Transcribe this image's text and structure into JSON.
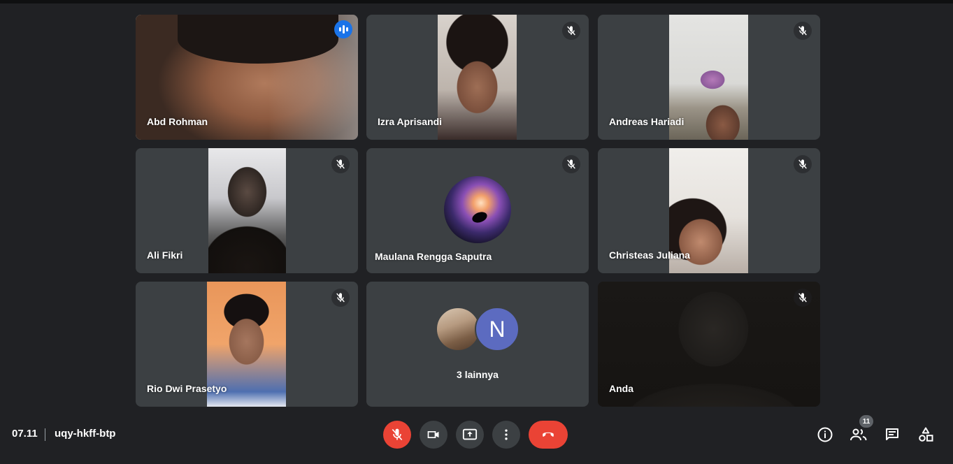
{
  "meeting": {
    "time": "07.11",
    "code": "uqy-hkff-btp",
    "participant_count": "11"
  },
  "tiles": [
    {
      "name": "Abd Rohman",
      "speaking": true
    },
    {
      "name": "Izra Aprisandi",
      "muted": true
    },
    {
      "name": "Andreas Hariadi",
      "muted": true
    },
    {
      "name": "Ali Fikri",
      "muted": true
    },
    {
      "name": "Maulana Rengga Saputra",
      "muted": true
    },
    {
      "name": "Christeas Juliana",
      "muted": true
    },
    {
      "name": "Rio Dwi Prasetyo",
      "muted": true
    },
    {
      "name": "Anda",
      "muted": true
    }
  ],
  "others": {
    "label": "3 lainnya",
    "initial": "N",
    "initial_color": "#5c6bc0"
  },
  "colors": {
    "background": "#202124",
    "tile": "#3c4043",
    "active_border": "#8ab4f8",
    "danger": "#ea4335",
    "speaking": "#1a73e8"
  },
  "icons": {
    "tile_status": "mic-off-icon",
    "speaking": "audio-level-icon",
    "controls": [
      "mic-off-icon",
      "camera-icon",
      "present-screen-icon",
      "more-options-icon",
      "end-call-icon"
    ],
    "right_panel": [
      "info-icon",
      "people-icon",
      "chat-icon",
      "activities-icon"
    ]
  }
}
